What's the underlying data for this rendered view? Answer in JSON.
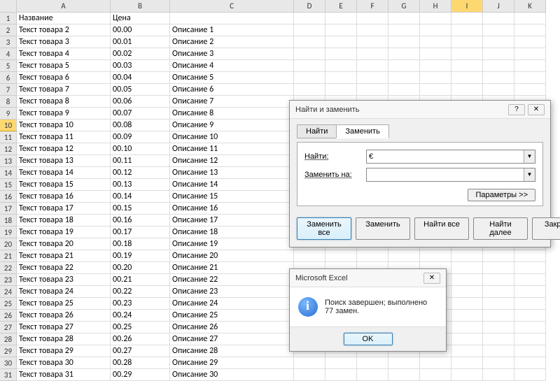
{
  "columns": [
    "A",
    "B",
    "C",
    "D",
    "E",
    "F",
    "G",
    "H",
    "I",
    "J",
    "K"
  ],
  "selectedCol": "I",
  "selectedRow": 10,
  "headers": {
    "a": "Название",
    "b": "Цена"
  },
  "rows": [
    {
      "n": 2,
      "a": "Текст товара 2",
      "b": "00.00",
      "c": "Описание 1"
    },
    {
      "n": 3,
      "a": "Текст товара 3",
      "b": "00.01",
      "c": "Описание 2"
    },
    {
      "n": 4,
      "a": "Текст товара 4",
      "b": "00.02",
      "c": "Описание 3"
    },
    {
      "n": 5,
      "a": "Текст товара 5",
      "b": "00.03",
      "c": "Описание 4"
    },
    {
      "n": 6,
      "a": "Текст товара 6",
      "b": "00.04",
      "c": "Описание 5"
    },
    {
      "n": 7,
      "a": "Текст товара 7",
      "b": "00.05",
      "c": "Описание 6"
    },
    {
      "n": 8,
      "a": "Текст товара 8",
      "b": "00.06",
      "c": "Описание 7"
    },
    {
      "n": 9,
      "a": "Текст товара 9",
      "b": "00.07",
      "c": "Описание 8"
    },
    {
      "n": 10,
      "a": "Текст товара 10",
      "b": "00.08",
      "c": "Описание 9"
    },
    {
      "n": 11,
      "a": "Текст товара 11",
      "b": "00.09",
      "c": "Описание 10"
    },
    {
      "n": 12,
      "a": "Текст товара 12",
      "b": "00.10",
      "c": "Описание 11"
    },
    {
      "n": 13,
      "a": "Текст товара 13",
      "b": "00.11",
      "c": "Описание 12"
    },
    {
      "n": 14,
      "a": "Текст товара 14",
      "b": "00.12",
      "c": "Описание 13"
    },
    {
      "n": 15,
      "a": "Текст товара 15",
      "b": "00.13",
      "c": "Описание 14"
    },
    {
      "n": 16,
      "a": "Текст товара 16",
      "b": "00.14",
      "c": "Описание 15"
    },
    {
      "n": 17,
      "a": "Текст товара 17",
      "b": "00.15",
      "c": "Описание 16"
    },
    {
      "n": 18,
      "a": "Текст товара 18",
      "b": "00.16",
      "c": "Описание 17"
    },
    {
      "n": 19,
      "a": "Текст товара 19",
      "b": "00.17",
      "c": "Описание 18"
    },
    {
      "n": 20,
      "a": "Текст товара 20",
      "b": "00.18",
      "c": "Описание 19"
    },
    {
      "n": 21,
      "a": "Текст товара 21",
      "b": "00.19",
      "c": "Описание 20"
    },
    {
      "n": 22,
      "a": "Текст товара 22",
      "b": "00.20",
      "c": "Описание 21"
    },
    {
      "n": 23,
      "a": "Текст товара 23",
      "b": "00.21",
      "c": "Описание 22"
    },
    {
      "n": 24,
      "a": "Текст товара 24",
      "b": "00.22",
      "c": "Описание 23"
    },
    {
      "n": 25,
      "a": "Текст товара 25",
      "b": "00.23",
      "c": "Описание 24"
    },
    {
      "n": 26,
      "a": "Текст товара 26",
      "b": "00.24",
      "c": "Описание 25"
    },
    {
      "n": 27,
      "a": "Текст товара 27",
      "b": "00.25",
      "c": "Описание 26"
    },
    {
      "n": 28,
      "a": "Текст товара 28",
      "b": "00.26",
      "c": "Описание 27"
    },
    {
      "n": 29,
      "a": "Текст товара 29",
      "b": "00.27",
      "c": "Описание 28"
    },
    {
      "n": 30,
      "a": "Текст товара 30",
      "b": "00.28",
      "c": "Описание 29"
    },
    {
      "n": 31,
      "a": "Текст товара 31",
      "b": "00.29",
      "c": "Описание 30"
    }
  ],
  "findReplace": {
    "title": "Найти и заменить",
    "help": "?",
    "close": "✕",
    "tabs": {
      "find": "Найти",
      "replace": "Заменить"
    },
    "labels": {
      "find": "Найти:",
      "replace": "Заменить на:"
    },
    "values": {
      "find": "€",
      "replace": ""
    },
    "params": "Параметры >>",
    "buttons": {
      "replaceAll": "Заменить все",
      "replace": "Заменить",
      "findAll": "Найти все",
      "findNext": "Найти далее",
      "close": "Закрыть"
    }
  },
  "msgbox": {
    "title": "Microsoft Excel",
    "close": "✕",
    "text": "Поиск завершен; выполнено 77 замен.",
    "ok": "OK"
  }
}
